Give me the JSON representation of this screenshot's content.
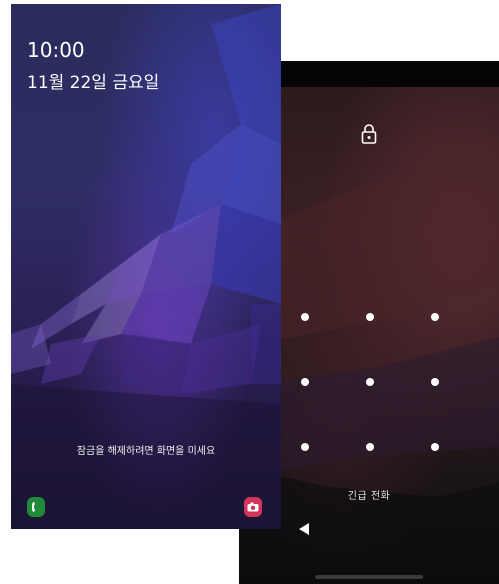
{
  "lock_screen": {
    "time": "10:00",
    "date": "11월 22일 금요일",
    "swipe_hint": "잠금을 해제하려면 화면을 미세요",
    "phone_icon": "phone-icon",
    "camera_icon": "camera-icon",
    "phone_color": "#1f8a3a",
    "camera_color": "#d1365a"
  },
  "pattern_screen": {
    "lock_icon": "lock-icon",
    "emergency_call": "긴급 전화",
    "back_icon": "back-triangle-icon",
    "dots": [
      {
        "row": 1,
        "col": 1
      },
      {
        "row": 1,
        "col": 2
      },
      {
        "row": 1,
        "col": 3
      },
      {
        "row": 2,
        "col": 1
      },
      {
        "row": 2,
        "col": 2
      },
      {
        "row": 2,
        "col": 3
      },
      {
        "row": 3,
        "col": 1
      },
      {
        "row": 3,
        "col": 2
      },
      {
        "row": 3,
        "col": 3
      }
    ]
  }
}
